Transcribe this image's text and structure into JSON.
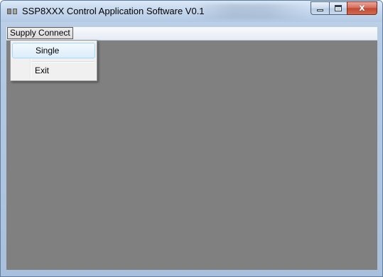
{
  "window": {
    "title": "SSP8XXX Control Application Software V0.1",
    "close_glyph": "x"
  },
  "menubar": {
    "items": [
      {
        "label": "Supply Connect"
      }
    ]
  },
  "dropdown": {
    "items": [
      {
        "label": "Single"
      },
      {
        "label": "Exit"
      }
    ]
  },
  "colors": {
    "client_background": "#808080",
    "titlebar": "#c6d8ee",
    "close_button": "#c24a33"
  },
  "icons": {
    "app": "app-icon",
    "minimize": "minimize-icon",
    "maximize": "maximize-icon",
    "close": "close-icon"
  }
}
